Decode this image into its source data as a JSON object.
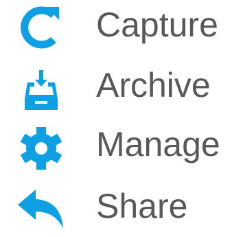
{
  "menu": {
    "items": [
      {
        "label": "Capture",
        "icon": "refresh-icon"
      },
      {
        "label": "Archive",
        "icon": "archive-tray-icon"
      },
      {
        "label": "Manage",
        "icon": "gear-icon"
      },
      {
        "label": "Share",
        "icon": "reply-arrow-icon"
      }
    ]
  },
  "colors": {
    "icon": "#0f9fe3",
    "text": "#58585a"
  }
}
